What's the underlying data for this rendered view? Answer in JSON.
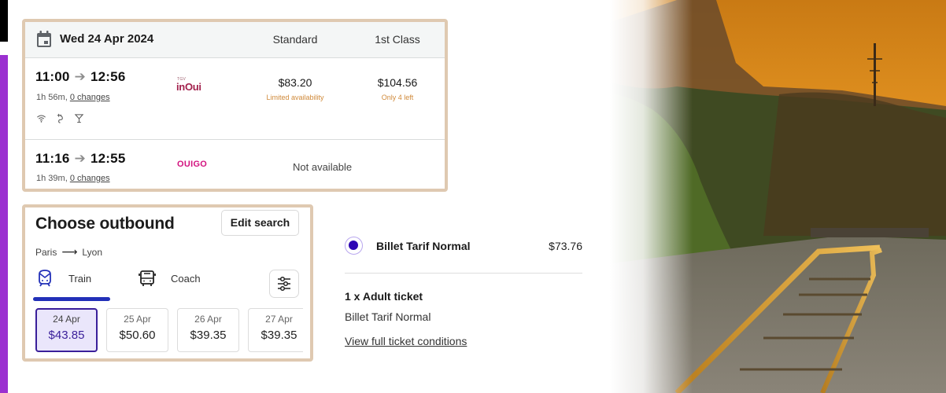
{
  "timetable": {
    "date": "Wed 24 Apr 2024",
    "columns": {
      "standard": "Standard",
      "first_class": "1st Class"
    },
    "journeys": [
      {
        "depart": "11:00",
        "arrive": "12:56",
        "duration": "1h 56m,",
        "changes": "0 changes",
        "operator": {
          "name": "inOui",
          "prefix": "TGV"
        },
        "amenities": [
          "wifi-icon",
          "power-plug-icon",
          "bar-icon"
        ],
        "standard_price": "$83.20",
        "standard_note": "Limited availability",
        "first_price": "$104.56",
        "first_note": "Only 4 left"
      },
      {
        "depart": "11:16",
        "arrive": "12:55",
        "duration": "1h 39m,",
        "changes": "0 changes",
        "operator": {
          "name": "OUIGO"
        },
        "availability": "Not available"
      }
    ]
  },
  "outbound": {
    "title": "Choose outbound",
    "edit_label": "Edit search",
    "route": {
      "from": "Paris",
      "to": "Lyon"
    },
    "modes": [
      {
        "label": "Train",
        "active": true
      },
      {
        "label": "Coach",
        "active": false
      }
    ],
    "dates": [
      {
        "date": "24 Apr",
        "price": "$43.85",
        "selected": true
      },
      {
        "date": "25 Apr",
        "price": "$50.60",
        "selected": false
      },
      {
        "date": "26 Apr",
        "price": "$39.35",
        "selected": false
      },
      {
        "date": "27 Apr",
        "price": "$39.35",
        "selected": false
      }
    ]
  },
  "ticket": {
    "fare_name": "Billet Tarif Normal",
    "fare_price": "$73.76",
    "quantity_label": "1 x Adult ticket",
    "fare_subtitle": "Billet Tarif Normal",
    "conditions_link": "View full ticket conditions"
  },
  "colors": {
    "accent": "#2e07b4",
    "card_border": "#dfc9b1",
    "side_bar": "#9b30d0",
    "warning": "#d08a3a",
    "inoui": "#a3224d",
    "ouigo": "#d3137f"
  }
}
